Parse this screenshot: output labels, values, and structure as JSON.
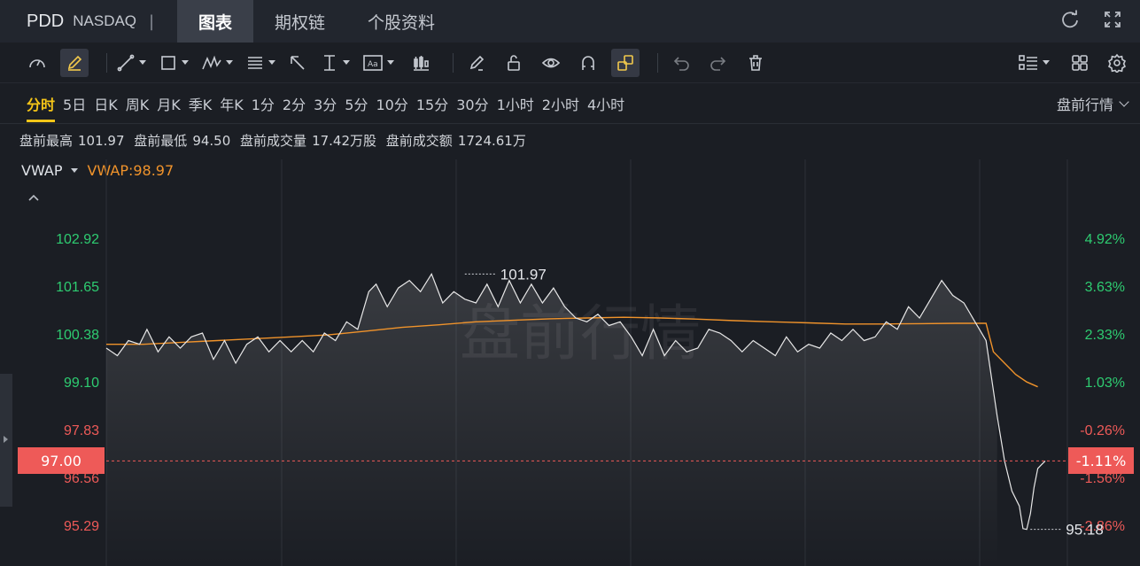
{
  "header": {
    "symbol": "PDD",
    "exchange": "NASDAQ",
    "separator": "|",
    "tabs": [
      {
        "label": "图表",
        "active": true
      },
      {
        "label": "期权链",
        "active": false
      },
      {
        "label": "个股资料",
        "active": false
      }
    ]
  },
  "toolbar": {
    "icons": [
      "gauge-icon",
      "pen-icon",
      "line-tool-icon",
      "rectangle-tool-icon",
      "pattern-tool-icon",
      "fib-tool-icon",
      "arrow-tool-icon",
      "measure-tool-icon",
      "text-tool-icon",
      "candle-tool-icon",
      "eraser-icon",
      "lock-icon",
      "eye-icon",
      "magnet-icon",
      "link-icon",
      "undo-icon",
      "redo-icon",
      "trash-icon",
      "layout-icon",
      "grid-icon",
      "settings-icon"
    ],
    "text_tool_label": "Aa"
  },
  "periods": {
    "items": [
      "分时",
      "5日",
      "日K",
      "周K",
      "月K",
      "季K",
      "年K",
      "1分",
      "2分",
      "3分",
      "5分",
      "10分",
      "15分",
      "30分",
      "1小时",
      "2小时",
      "4小时"
    ],
    "active": "分时",
    "mode_label": "盘前行情"
  },
  "stats": {
    "high_label": "盘前最高",
    "high_value": "101.97",
    "low_label": "盘前最低",
    "low_value": "94.50",
    "volume_label": "盘前成交量",
    "volume_value": "17.42万股",
    "turnover_label": "盘前成交额",
    "turnover_value": "1724.61万"
  },
  "indicator": {
    "name": "VWAP",
    "value_label": "VWAP:98.97",
    "color": "#f0932b"
  },
  "watermark": "盘前行情",
  "current": {
    "price": "97.00",
    "change_pct": "-1.11%",
    "color": "#ee5a58"
  },
  "colors": {
    "up": "#2ecc71",
    "down": "#ee5a58",
    "price_line": "#e8e8e8",
    "vwap_line": "#f0932b"
  },
  "chart_data": {
    "type": "line",
    "title": "",
    "xlabel": "",
    "ylabel": "",
    "ylim": [
      94.6,
      104.3
    ],
    "left_ticks": [
      {
        "label": "102.92",
        "value": 102.92,
        "dir": "up"
      },
      {
        "label": "101.65",
        "value": 101.65,
        "dir": "up"
      },
      {
        "label": "100.38",
        "value": 100.38,
        "dir": "up"
      },
      {
        "label": "99.10",
        "value": 99.1,
        "dir": "up"
      },
      {
        "label": "97.83",
        "value": 97.83,
        "dir": "down"
      },
      {
        "label": "96.56",
        "value": 96.56,
        "dir": "down"
      },
      {
        "label": "95.29",
        "value": 95.29,
        "dir": "down"
      }
    ],
    "right_ticks": [
      {
        "label": "4.92%",
        "value": 102.92,
        "dir": "up"
      },
      {
        "label": "3.63%",
        "value": 101.65,
        "dir": "up"
      },
      {
        "label": "2.33%",
        "value": 100.38,
        "dir": "up"
      },
      {
        "label": "1.03%",
        "value": 99.1,
        "dir": "up"
      },
      {
        "label": "-0.26%",
        "value": 97.83,
        "dir": "down"
      },
      {
        "label": "-1.56%",
        "value": 96.56,
        "dir": "down"
      },
      {
        "label": "-2.86%",
        "value": 95.29,
        "dir": "down"
      }
    ],
    "annotations": [
      {
        "label": "101.97",
        "x": 97,
        "y": 101.97
      },
      {
        "label": "95.18",
        "x": 250,
        "y": 95.18
      }
    ],
    "current_price": 97.0,
    "x_count": 260,
    "series": [
      {
        "key": "price",
        "x": [
          0,
          3,
          6,
          9,
          11,
          14,
          17,
          20,
          23,
          26,
          29,
          32,
          35,
          38,
          41,
          44,
          47,
          50,
          53,
          56,
          59,
          62,
          65,
          68,
          71,
          73,
          76,
          79,
          82,
          85,
          88,
          91,
          94,
          97,
          100,
          103,
          106,
          109,
          112,
          115,
          118,
          121,
          124,
          127,
          130,
          133,
          136,
          139,
          142,
          145,
          148,
          151,
          154,
          157,
          160,
          163,
          166,
          169,
          172,
          175,
          178,
          181,
          184,
          187,
          190,
          193,
          196,
          199,
          202,
          205,
          208,
          211,
          214,
          217,
          220,
          223,
          226,
          229,
          232,
          235,
          238,
          241,
          243,
          245,
          247,
          248,
          249,
          250,
          251,
          252,
          253,
          254
        ],
        "values": [
          100.0,
          99.8,
          100.2,
          100.1,
          100.5,
          99.9,
          100.3,
          100.0,
          100.3,
          100.4,
          99.7,
          100.2,
          99.6,
          100.1,
          100.3,
          99.9,
          100.2,
          99.9,
          100.2,
          99.9,
          100.4,
          100.2,
          100.7,
          100.5,
          101.5,
          101.7,
          101.1,
          101.6,
          101.8,
          101.5,
          101.97,
          101.2,
          101.5,
          101.3,
          101.2,
          101.7,
          101.1,
          101.8,
          101.2,
          101.7,
          101.2,
          101.6,
          101.1,
          100.8,
          100.7,
          100.9,
          100.6,
          100.7,
          100.3,
          99.8,
          100.5,
          99.8,
          100.2,
          99.9,
          100.0,
          100.5,
          100.4,
          100.2,
          99.9,
          100.2,
          100.0,
          99.8,
          100.3,
          99.9,
          100.1,
          100.0,
          100.4,
          100.2,
          100.5,
          100.2,
          100.3,
          100.7,
          100.5,
          101.1,
          100.8,
          101.3,
          101.8,
          101.4,
          101.2,
          100.7,
          100.2,
          98.2,
          97.0,
          96.2,
          95.8,
          95.2,
          95.18,
          95.6,
          96.3,
          96.8,
          96.9,
          97.0
        ]
      },
      {
        "key": "vwap",
        "x": [
          0,
          10,
          20,
          30,
          40,
          50,
          60,
          70,
          80,
          90,
          100,
          110,
          120,
          130,
          140,
          150,
          160,
          170,
          180,
          190,
          200,
          210,
          220,
          230,
          238,
          240,
          243,
          246,
          249,
          252
        ],
        "values": [
          100.1,
          100.1,
          100.15,
          100.2,
          100.25,
          100.3,
          100.35,
          100.45,
          100.55,
          100.62,
          100.7,
          100.74,
          100.78,
          100.8,
          100.82,
          100.8,
          100.77,
          100.73,
          100.7,
          100.67,
          100.64,
          100.64,
          100.65,
          100.66,
          100.66,
          99.9,
          99.6,
          99.3,
          99.1,
          98.97
        ]
      }
    ]
  }
}
